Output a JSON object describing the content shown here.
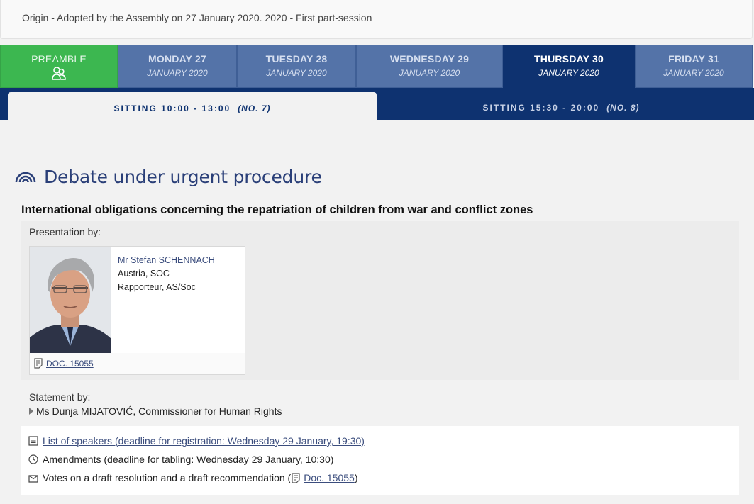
{
  "origin": "Origin - Adopted by the Assembly on 27 January 2020. 2020 - First part-session",
  "day_tabs": [
    {
      "day": "PREAMBLE",
      "month": "",
      "icon": "people-icon"
    },
    {
      "day": "MONDAY 27",
      "month": "JANUARY 2020"
    },
    {
      "day": "TUESDAY 28",
      "month": "JANUARY 2020"
    },
    {
      "day": "WEDNESDAY 29",
      "month": "JANUARY 2020"
    },
    {
      "day": "THURSDAY 30",
      "month": "JANUARY 2020"
    },
    {
      "day": "FRIDAY 31",
      "month": "JANUARY 2020"
    }
  ],
  "active_day": "THURSDAY 30",
  "sittings": [
    {
      "label": "SITTING 10:00 - 13:00",
      "no": "(NO. 7)"
    },
    {
      "label": "SITTING 15:30 - 20:00",
      "no": "(NO. 8)"
    }
  ],
  "section_heading": "Debate under urgent procedure",
  "debate_title": "International obligations concerning the repatriation of children from war and conflict zones",
  "presentation_label": "Presentation by:",
  "presenter": {
    "name": "Mr Stefan SCHENNACH",
    "country_group": "Austria, SOC",
    "role": "Rapporteur, AS/Soc",
    "doc": "DOC. 15055"
  },
  "statement_label": "Statement by:",
  "statement_person": "Ms Dunja MIJATOVIĆ, Commissioner for Human Rights",
  "info": {
    "speakers": "List of speakers (deadline for registration: Wednesday 29 January, 19:30)",
    "amendments": "Amendments (deadline for tabling: Wednesday 29 January, 10:30)",
    "votes_prefix": "Votes on a draft resolution and a draft recommendation (",
    "votes_doc": "Doc. 15055",
    "votes_suffix": ")"
  },
  "colors": {
    "navy": "#0e3270",
    "tab_blue": "#5473a8",
    "preamble_green": "#3cb750",
    "link": "#3b4d7d"
  }
}
